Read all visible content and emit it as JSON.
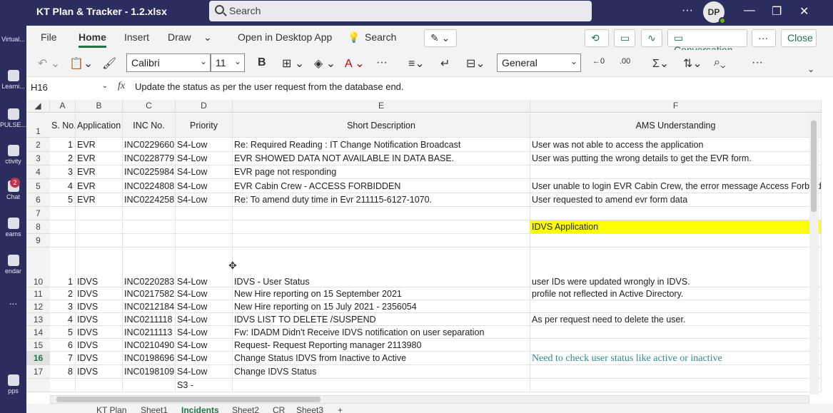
{
  "window": {
    "title": "KT Plan & Tracker - 1.2.xlsx",
    "search_placeholder": "Search",
    "avatar_initials": "DP"
  },
  "rail": {
    "items": [
      {
        "label": "Virtual..."
      },
      {
        "label": "Learni..."
      },
      {
        "label": "PULSE..."
      },
      {
        "label": "ctivity"
      },
      {
        "label": "Chat",
        "badge": "2"
      },
      {
        "label": "eams"
      },
      {
        "label": "endar"
      },
      {
        "label": "..."
      },
      {
        "label": "pps"
      }
    ]
  },
  "ribbon": {
    "tabs": [
      "File",
      "Home",
      "Insert",
      "Draw"
    ],
    "active_tab": "Home",
    "open_desktop": "Open in Desktop App",
    "search": "Search",
    "conversation": "Conversation",
    "close": "Close"
  },
  "toolbar": {
    "font_name": "Calibri",
    "font_size": "11",
    "number_format": "General"
  },
  "formula_bar": {
    "name_box": "H16",
    "fx": "fx",
    "formula": "Update the status as per the user request from the database end."
  },
  "columns": [
    "A",
    "B",
    "C",
    "D",
    "E",
    "F"
  ],
  "table": {
    "headers": [
      "S. No.",
      "Application",
      "INC No.",
      "Priority",
      "Short Description",
      "AMS Understanding"
    ],
    "rows": [
      {
        "row": "2",
        "sno": "1",
        "app": "EVR",
        "inc": "INC0229660",
        "pri": "S4-Low",
        "desc": "Re: Required Reading : IT Change Notification Broadcast",
        "ams": "User was not able to access the application"
      },
      {
        "row": "3",
        "sno": "2",
        "app": "EVR",
        "inc": "INC0228779",
        "pri": "S4-Low",
        "desc": "EVR SHOWED DATA NOT AVAILABLE IN DATA BASE.",
        "ams": "User was putting the wrong details to get the EVR form."
      },
      {
        "row": "4",
        "sno": "3",
        "app": "EVR",
        "inc": "INC0225984",
        "pri": "S4-Low",
        "desc": "EVR page not responding",
        "ams": ""
      },
      {
        "row": "5",
        "sno": "4",
        "app": "EVR",
        "inc": "INC0224808",
        "pri": "S4-Low",
        "desc": "EVR Cabin Crew - ACCESS FORBIDDEN",
        "ams": "User unable to login EVR Cabin Crew, the error message Access Forbidde"
      },
      {
        "row": "6",
        "sno": "5",
        "app": "EVR",
        "inc": "INC0224258",
        "pri": "S4-Low",
        "desc": "Re: To amend duty time in Evr 211115-6127-1070.",
        "ams": "User requested to amend evr form data"
      },
      {
        "row": "7",
        "sno": "",
        "app": "",
        "inc": "",
        "pri": "",
        "desc": "",
        "ams": ""
      },
      {
        "row": "8",
        "sno": "",
        "app": "",
        "inc": "",
        "pri": "",
        "desc": "",
        "ams": "IDVS Application"
      },
      {
        "row": "9",
        "sno": "",
        "app": "",
        "inc": "",
        "pri": "",
        "desc": "",
        "ams": ""
      },
      {
        "row": "10",
        "sno": "1",
        "app": "IDVS",
        "inc": "INC0220283",
        "pri": "S4-Low",
        "desc": "IDVS - User Status",
        "ams": "user IDs were updated wrongly in IDVS."
      },
      {
        "row": "11",
        "sno": "2",
        "app": "IDVS",
        "inc": "INC0217582",
        "pri": "S4-Low",
        "desc": "New Hire reporting on 15 September 2021",
        "ams": "profile not reflected in Active Directory."
      },
      {
        "row": "12",
        "sno": "3",
        "app": "IDVS",
        "inc": "INC0212184",
        "pri": "S4-Low",
        "desc": "New Hire reporting on 15 July 2021 - 2356054",
        "ams": ""
      },
      {
        "row": "13",
        "sno": "4",
        "app": "IDVS",
        "inc": "INC0211118",
        "pri": "S4-Low",
        "desc": "IDVS LIST TO DELETE /SUSPEND",
        "ams": "As per request need to delete the user."
      },
      {
        "row": "14",
        "sno": "5",
        "app": "IDVS",
        "inc": "INC0211113",
        "pri": "S4-Low",
        "desc": "Fw: IDADM Didn't Receive IDVS notification on user separation",
        "ams": ""
      },
      {
        "row": "15",
        "sno": "6",
        "app": "IDVS",
        "inc": "INC0210490",
        "pri": "S4-Low",
        "desc": "Request- Request Reporting manager 2113980",
        "ams": ""
      },
      {
        "row": "16",
        "sno": "7",
        "app": "IDVS",
        "inc": "INC0198696",
        "pri": "S4-Low",
        "desc": "Change Status IDVS from Inactive to Active",
        "ams": "Need to check user status like active or inactive"
      },
      {
        "row": "17",
        "sno": "8",
        "app": "IDVS",
        "inc": "INC0198109",
        "pri": "S4-Low",
        "desc": "Change IDVS Status",
        "ams": ""
      },
      {
        "row": "",
        "sno": "",
        "app": "",
        "inc": "",
        "pri": "S3 -",
        "desc": "",
        "ams": ""
      }
    ]
  },
  "sheet_tabs": [
    "KT Plan",
    "Sheet1",
    "Incidents",
    "Sheet2",
    "CR",
    "Sheet3",
    "+"
  ],
  "active_sheet": "Incidents",
  "colors": {
    "header_bg": "#2b2d5e",
    "excel_green": "#217346",
    "highlight_yellow": "#ffff00",
    "note_teal": "#2e8b8b"
  }
}
